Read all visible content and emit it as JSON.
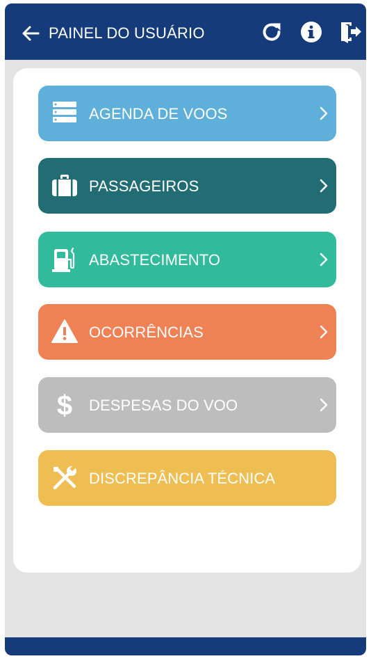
{
  "header": {
    "title": "PAINEL DO USUÁRIO",
    "back_icon": "arrow-left-icon",
    "refresh_icon": "refresh-icon",
    "info_icon": "info-icon",
    "logout_icon": "logout-icon"
  },
  "colors": {
    "header": "#153b7b",
    "agenda": "#5eafd9",
    "passageiros": "#226c74",
    "abastecimento": "#31bb9c",
    "ocorrencias": "#ef8254",
    "despesas": "#bdbdbd",
    "discrepancia": "#efbe52"
  },
  "menu": [
    {
      "label": "AGENDA DE VOOS",
      "icon": "list-icon",
      "chevron": true
    },
    {
      "label": "PASSAGEIROS",
      "icon": "briefcase-icon",
      "chevron": true
    },
    {
      "label": "ABASTECIMENTO",
      "icon": "fuel-pump-icon",
      "chevron": true
    },
    {
      "label": "OCORRÊNCIAS",
      "icon": "warning-icon",
      "chevron": true
    },
    {
      "label": "DESPESAS DO VOO",
      "icon": "dollar-icon",
      "chevron": true
    },
    {
      "label": "DISCREPÂNCIA TÉCNICA",
      "icon": "tools-icon",
      "chevron": false
    }
  ]
}
